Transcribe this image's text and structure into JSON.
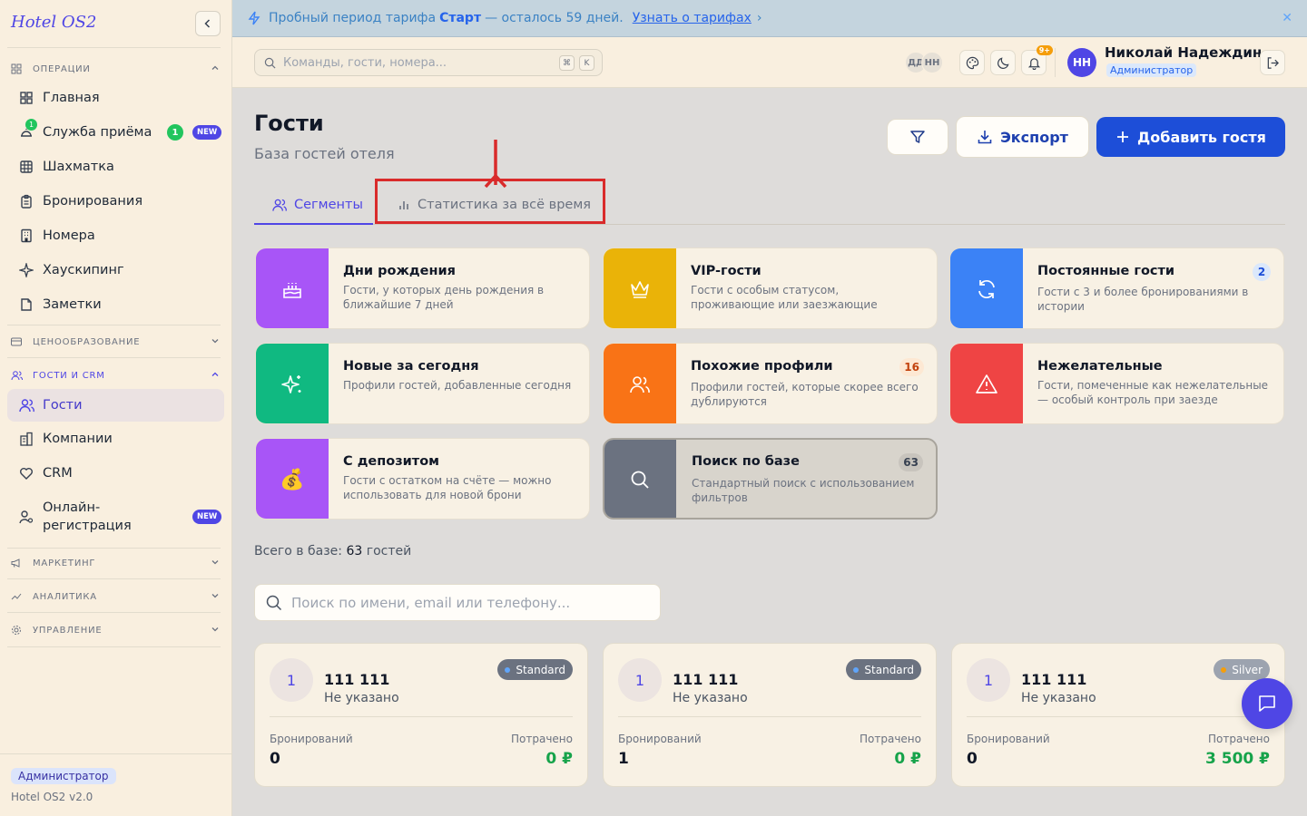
{
  "app": {
    "name": "Hotel OS2",
    "version": "Hotel OS2 v2.0"
  },
  "sidebar": {
    "sections": {
      "operations": "ОПЕРАЦИИ",
      "pricing": "ЦЕНООБРАЗОВАНИЕ",
      "guests_crm": "ГОСТИ И CRM",
      "marketing": "МАРКЕТИНГ",
      "analytics": "АНАЛИТИКА",
      "management": "УПРАВЛЕНИЕ"
    },
    "items": {
      "home": "Главная",
      "reception": "Служба приёма",
      "reception_count": "1",
      "reception_mini": "1",
      "chess": "Шахматка",
      "bookings": "Бронирования",
      "rooms": "Номера",
      "housekeeping": "Хаускипинг",
      "notes": "Заметки",
      "guests": "Гости",
      "companies": "Компании",
      "crm": "CRM",
      "online_reg_1": "Онлайн-",
      "online_reg_2": "регистрация"
    },
    "new_badge": "NEW",
    "role": "Администратор"
  },
  "banner": {
    "text_before": "Пробный период тарифа",
    "plan": "Старт",
    "text_after": "— осталось 59 дней.",
    "link": "Узнать о тарифах",
    "link_chevron": "›",
    "close": "✕"
  },
  "topbar": {
    "search_placeholder": "Команды, гости, номера...",
    "kbd_1": "⌘",
    "kbd_2": "K",
    "avatars": [
      "ДД",
      "НН"
    ],
    "notif_badge": "9+",
    "user_initials": "НН",
    "user_name": "Николай Надеждин",
    "user_role": "Администратор"
  },
  "page": {
    "title": "Гости",
    "subtitle": "База гостей отеля",
    "export": "Экспорт",
    "add": "Добавить гостя"
  },
  "tabs": {
    "segments": "Сегменты",
    "stats": "Статистика за всё время"
  },
  "segments": [
    {
      "title": "Дни рождения",
      "desc": "Гости, у которых день рождения в ближайшие 7 дней",
      "color": "#a855f7",
      "icon": "cake-icon"
    },
    {
      "title": "VIP-гости",
      "desc": "Гости с особым статусом, проживающие или заезжающие",
      "color": "#eab308",
      "icon": "crown-icon"
    },
    {
      "title": "Постоянные гости",
      "desc": "Гости с 3 и более бронированиями в истории",
      "count": "2",
      "color": "#3b82f6",
      "icon": "refresh-icon"
    },
    {
      "title": "Новые за сегодня",
      "desc": "Профили гостей, добавленные сегодня",
      "color": "#10b981",
      "icon": "sparkles-icon"
    },
    {
      "title": "Похожие профили",
      "desc": "Профили гостей, которые скорее всего дублируются",
      "count": "16",
      "color": "#f97316",
      "icon": "users-icon"
    },
    {
      "title": "Нежелательные",
      "desc": "Гости, помеченные как нежелательные — особый контроль при заезде",
      "color": "#ef4444",
      "icon": "warning-icon"
    },
    {
      "title": "С депозитом",
      "desc": "Гости с остатком на счёте — можно использовать для новой брони",
      "color": "#a855f7",
      "icon": "money-bag-icon",
      "emoji": "💰"
    },
    {
      "title": "Поиск по базе",
      "desc": "Стандартный поиск с использованием фильтров",
      "count": "63",
      "color": "#6b7280",
      "icon": "search-icon"
    }
  ],
  "total": {
    "label": "Всего в базе:",
    "count": "63",
    "unit": "гостей"
  },
  "guest_search_placeholder": "Поиск по имени, email или телефону...",
  "guests": [
    {
      "initial": "1",
      "name": "111 111",
      "sub": "Не указано",
      "tier": "Standard",
      "bookings_label": "Бронирований",
      "bookings": "0",
      "spent_label": "Потрачено",
      "spent": "0 ₽"
    },
    {
      "initial": "1",
      "name": "111 111",
      "sub": "Не указано",
      "tier": "Standard",
      "bookings_label": "Бронирований",
      "bookings": "1",
      "spent_label": "Потрачено",
      "spent": "0 ₽"
    },
    {
      "initial": "1",
      "name": "111 111",
      "sub": "Не указано",
      "tier": "Silver",
      "bookings_label": "Бронирований",
      "bookings": "0",
      "spent_label": "Потрачено",
      "spent": "3 500 ₽"
    }
  ]
}
